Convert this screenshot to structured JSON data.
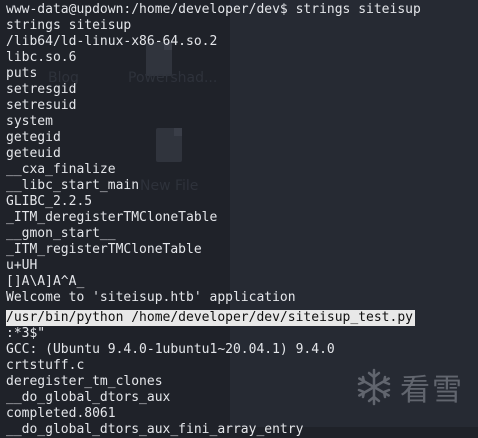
{
  "terminal": {
    "prompt": "www-data@updown:/home/developer/dev$ strings siteisup",
    "lines": [
      "strings siteisup",
      "/lib64/ld-linux-x86-64.so.2",
      "libc.so.6",
      "puts",
      "setresgid",
      "setresuid",
      "system",
      "getegid",
      "geteuid",
      "__cxa_finalize",
      "__libc_start_main",
      "GLIBC_2.2.5",
      "_ITM_deregisterTMCloneTable",
      "__gmon_start__",
      "_ITM_registerTMCloneTable",
      "u+UH",
      "[]A\\A]A^A_",
      "Welcome to 'siteisup.htb' application",
      "/usr/bin/python /home/developer/dev/siteisup_test.py",
      ":*3$\"",
      "GCC: (Ubuntu 9.4.0-1ubuntu1~20.04.1) 9.4.0",
      "crtstuff.c",
      "deregister_tm_clones",
      "__do_global_dtors_aux",
      "completed.8061",
      "__do_global_dtors_aux_fini_array_entry"
    ],
    "highlighted_line_index": 18
  },
  "background": {
    "ghost_labels": [
      "Blog",
      "Powershad...",
      "New File"
    ]
  },
  "watermark": {
    "icon": "snowflake-icon",
    "text": "看雪"
  },
  "colors": {
    "background": "#1f2229",
    "text": "#e4e6ea",
    "highlight_bg": "#e8e8e8",
    "highlight_text": "#101010"
  }
}
